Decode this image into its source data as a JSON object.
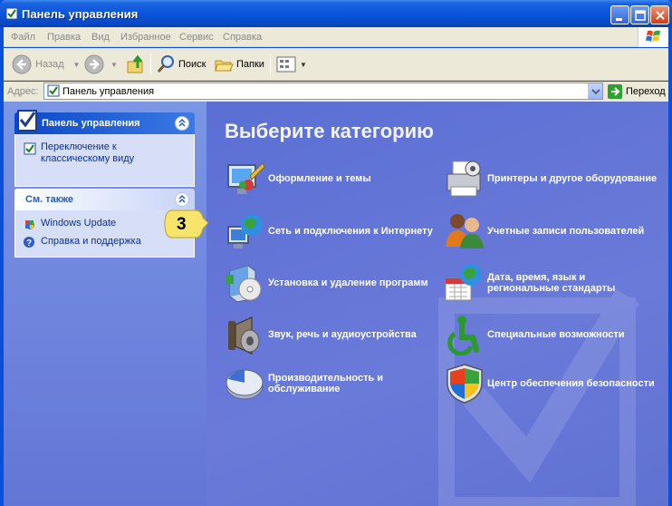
{
  "window": {
    "title": "Панель управления"
  },
  "menu": [
    "Файл",
    "Правка",
    "Вид",
    "Избранное",
    "Сервис",
    "Справка"
  ],
  "toolbar": {
    "back_label": "Назад",
    "search_label": "Поиск",
    "folders_label": "Папки"
  },
  "address": {
    "label": "Адрес:",
    "value": "Панель управления",
    "go_label": "Переход"
  },
  "left_panels": {
    "control_panel": {
      "title": "Панель управления",
      "link": "Переключение к классическому виду"
    },
    "see_also": {
      "title": "См. также",
      "links": [
        "Windows Update",
        "Справка и поддержка"
      ]
    }
  },
  "main": {
    "heading": "Выберите категорию",
    "categories_left": [
      {
        "label": "Оформление и темы",
        "icon": "appearance-themes-icon"
      },
      {
        "label": "Сеть и подключения к Интернету",
        "icon": "network-internet-icon"
      },
      {
        "label": "Установка и удаление программ",
        "icon": "add-remove-programs-icon"
      },
      {
        "label": "Звук, речь и аудиоустройства",
        "icon": "sound-speech-icon"
      },
      {
        "label": "Производительность и обслуживание",
        "icon": "performance-maintenance-icon"
      }
    ],
    "categories_right": [
      {
        "label": "Принтеры и другое оборудование",
        "icon": "printer-hardware-icon"
      },
      {
        "label": "Учетные записи пользователей",
        "icon": "user-accounts-icon"
      },
      {
        "label": "Дата, время, язык и региональные стандарты",
        "icon": "date-time-region-icon"
      },
      {
        "label": "Специальные возможности",
        "icon": "accessibility-icon"
      },
      {
        "label": "Центр обеспечения безопасности",
        "icon": "security-center-icon"
      }
    ]
  },
  "callout": {
    "number": "3"
  },
  "colors": {
    "titlebar": "#0a56da",
    "content_bg": "#6375d6",
    "link": "#0c2f9a",
    "callout": "#f7e46a"
  }
}
